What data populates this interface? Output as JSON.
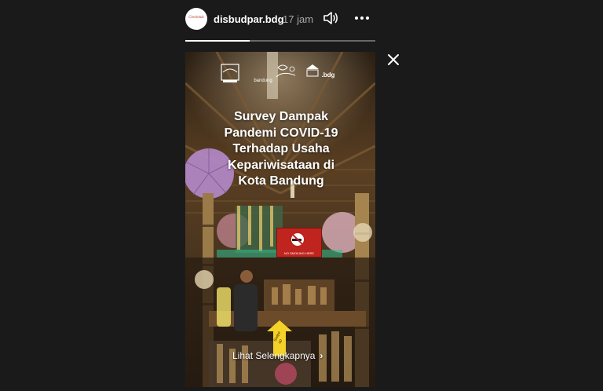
{
  "header": {
    "username": "disbudpar.bdg",
    "time": "17 jam",
    "avatar_text": "Gemintuk"
  },
  "progress": {
    "fraction": 0.34
  },
  "story": {
    "logos": {
      "center_text": "bandung",
      "right_text": ".bdg"
    },
    "title_lines": [
      "Survey Dampak",
      "Pandemi COVID-19",
      "Terhadap Usaha",
      "Kepariwisataan di",
      "Kota Bandung"
    ],
    "sign_text": "NO SMOKING HERE",
    "swipe_text": "Swipe up",
    "cta_label": "Lihat Selengkapnya"
  },
  "icons": {
    "speaker": "speaker-icon",
    "more": "more-icon",
    "close": "close-icon",
    "chevron": "chevron-right-icon"
  },
  "colors": {
    "background": "#1a1a1a",
    "text": "#ffffff",
    "muted": "#a8a8a8",
    "sign_red": "#c0241e",
    "swipe_yellow": "#f5d228"
  }
}
